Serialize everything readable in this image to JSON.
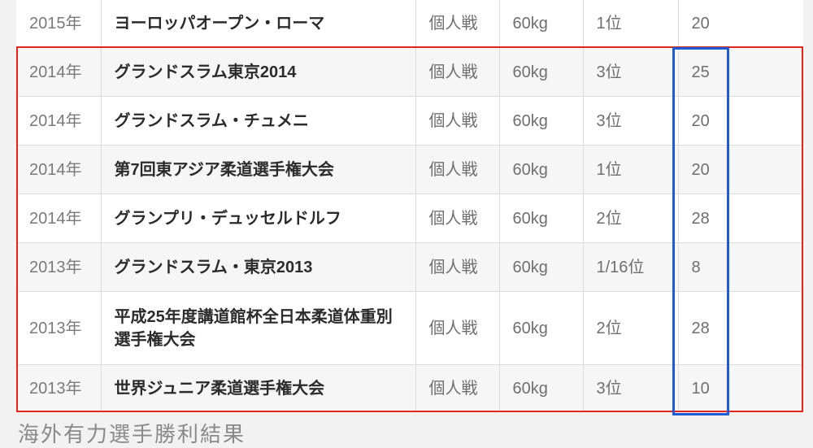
{
  "table": {
    "rows": [
      {
        "year": "2015年",
        "event": "ヨーロッパオープン・ローマ",
        "type": "個人戦",
        "weight": "60kg",
        "place": "1位",
        "points": "20"
      },
      {
        "year": "2014年",
        "event": "グランドスラム東京2014",
        "type": "個人戦",
        "weight": "60kg",
        "place": "3位",
        "points": "25"
      },
      {
        "year": "2014年",
        "event": "グランドスラム・チュメニ",
        "type": "個人戦",
        "weight": "60kg",
        "place": "3位",
        "points": "20"
      },
      {
        "year": "2014年",
        "event": "第7回東アジア柔道選手権大会",
        "type": "個人戦",
        "weight": "60kg",
        "place": "1位",
        "points": "20"
      },
      {
        "year": "2014年",
        "event": "グランプリ・デュッセルドルフ",
        "type": "個人戦",
        "weight": "60kg",
        "place": "2位",
        "points": "28"
      },
      {
        "year": "2013年",
        "event": "グランドスラム・東京2013",
        "type": "個人戦",
        "weight": "60kg",
        "place": "1/16位",
        "points": "8"
      },
      {
        "year": "2013年",
        "event": "平成25年度講道館杯全日本柔道体重別選手権大会",
        "type": "個人戦",
        "weight": "60kg",
        "place": "2位",
        "points": "28"
      },
      {
        "year": "2013年",
        "event": "世界ジュニア柔道選手権大会",
        "type": "個人戦",
        "weight": "60kg",
        "place": "3位",
        "points": "10"
      }
    ]
  },
  "section_heading": "海外有力選手勝利結果",
  "colors": {
    "highlight_red": "#e1261c",
    "highlight_blue": "#1f5bd6",
    "row_alt": "#f6f6f6",
    "page_bg": "#f1f2f1"
  }
}
